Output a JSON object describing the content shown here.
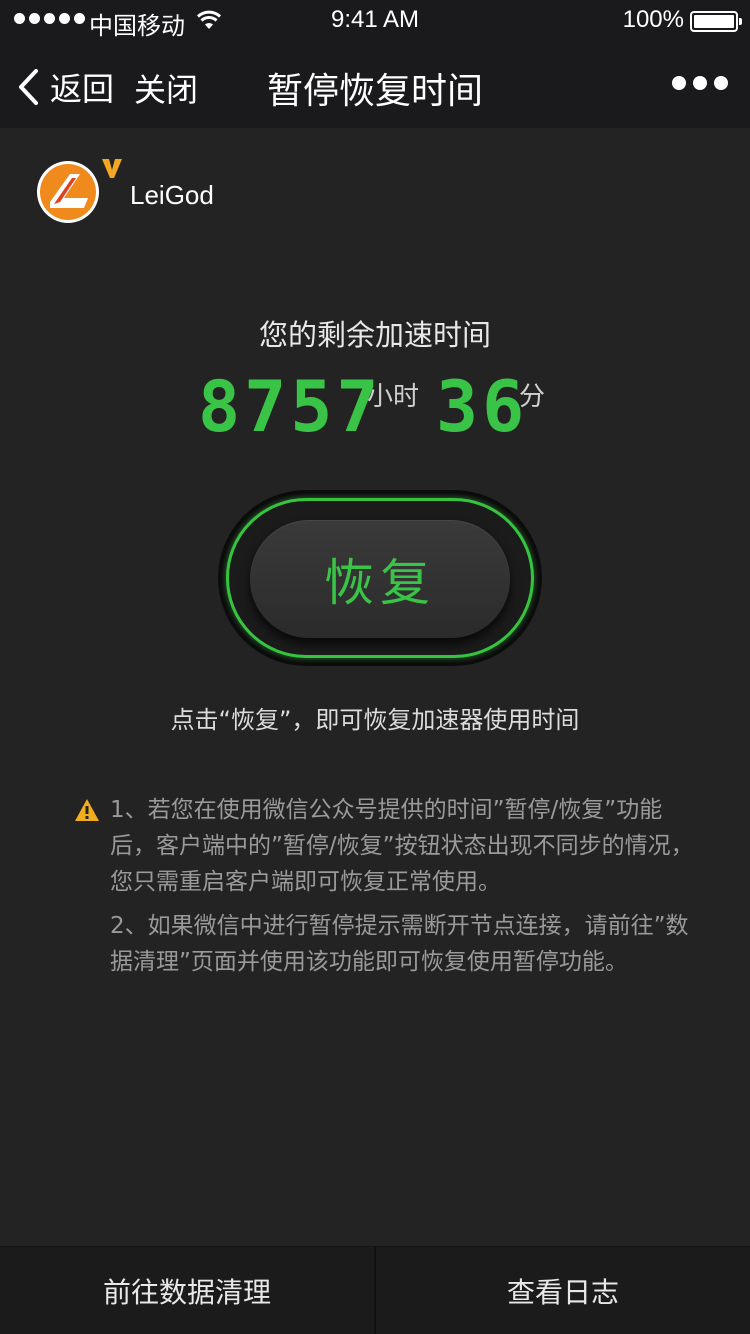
{
  "status_bar": {
    "carrier": "中国移动",
    "time": "9:41 AM",
    "battery": "100%"
  },
  "nav": {
    "back_label": "返回",
    "close_label": "关闭",
    "title": "暂停恢复时间"
  },
  "brand": {
    "name": "LeiGod",
    "logo_letters": "LV",
    "accent": "#f5a623"
  },
  "timer": {
    "label": "您的剩余加速时间",
    "hours": "8757",
    "hours_unit": "小时",
    "minutes": "36",
    "minutes_unit": "分",
    "digit_color": "#3ac447"
  },
  "action": {
    "button_label": "恢复",
    "hint": "点击“恢复”，即可恢复加速器使用时间"
  },
  "notes": [
    "1、若您在使用微信公众号提供的时间”暂停/恢复”功能后，客户端中的”暂停/恢复”按钮状态出现不同步的情况，您只需重启客户端即可恢复正常使用。",
    "2、如果微信中进行暂停提示需断开节点连接，请前往”数据清理”页面并使用该功能即可恢复使用暂停功能。"
  ],
  "bottom_bar": {
    "left_label": "前往数据清理",
    "right_label": "查看日志"
  }
}
